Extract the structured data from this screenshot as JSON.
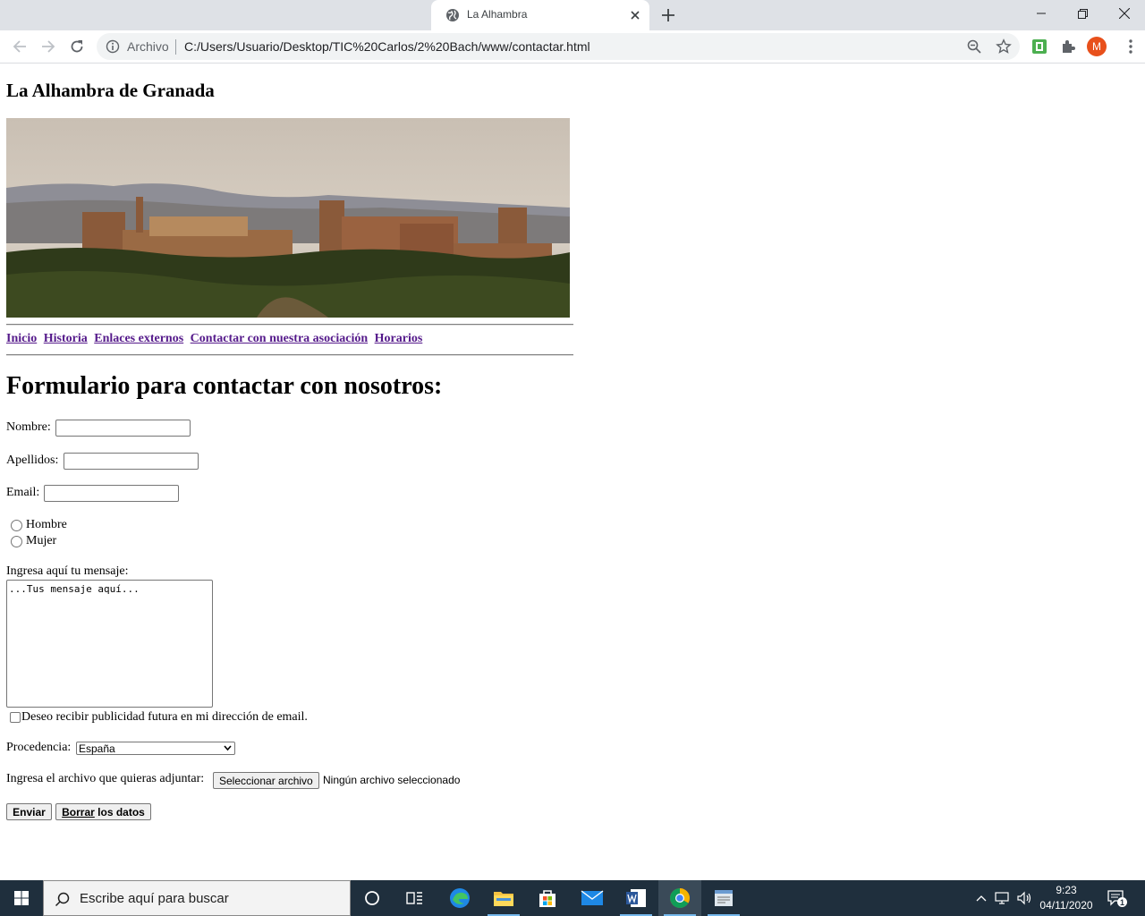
{
  "browser": {
    "tab_title": "La Alhambra",
    "omnibox_chip": "Archivo",
    "url": "C:/Users/Usuario/Desktop/TIC%20Carlos/2%20Bach/www/contactar.html",
    "profile_initial": "M"
  },
  "page": {
    "site_title": "La Alhambra de Granada",
    "nav": [
      "Inicio",
      "Historia",
      "Enlaces externos",
      "Contactar con nuestra asociación",
      "Horarios"
    ],
    "form_title": "Formulario para contactar con nosotros:",
    "fields": {
      "nombre_label": "Nombre:",
      "apellidos_label": "Apellidos:",
      "email_label": "Email:",
      "radio_hombre": "Hombre",
      "radio_mujer": "Mujer",
      "mensaje_label": "Ingresa aquí tu mensaje:",
      "mensaje_value": "...Tus mensaje aquí...",
      "checkbox_label": "Deseo recibir publicidad futura en mi dirección de email.",
      "procedencia_label": "Procedencia:",
      "procedencia_value": "España",
      "archivo_label": "Ingresa el archivo que quieras adjuntar:",
      "archivo_button": "Seleccionar archivo",
      "archivo_status": "Ningún archivo seleccionado"
    },
    "buttons": {
      "submit": "Enviar",
      "reset_underlined": "Borrar",
      "reset_rest": " los datos"
    }
  },
  "taskbar": {
    "search_placeholder": "Escribe aquí para buscar",
    "time": "9:23",
    "date": "04/11/2020",
    "notification_count": "1"
  },
  "colors": {
    "visited_link": "#551a8b",
    "taskbar_bg": "#1f2f3d",
    "tabstrip_bg": "#dee1e6",
    "avatar": "#e8501b"
  }
}
